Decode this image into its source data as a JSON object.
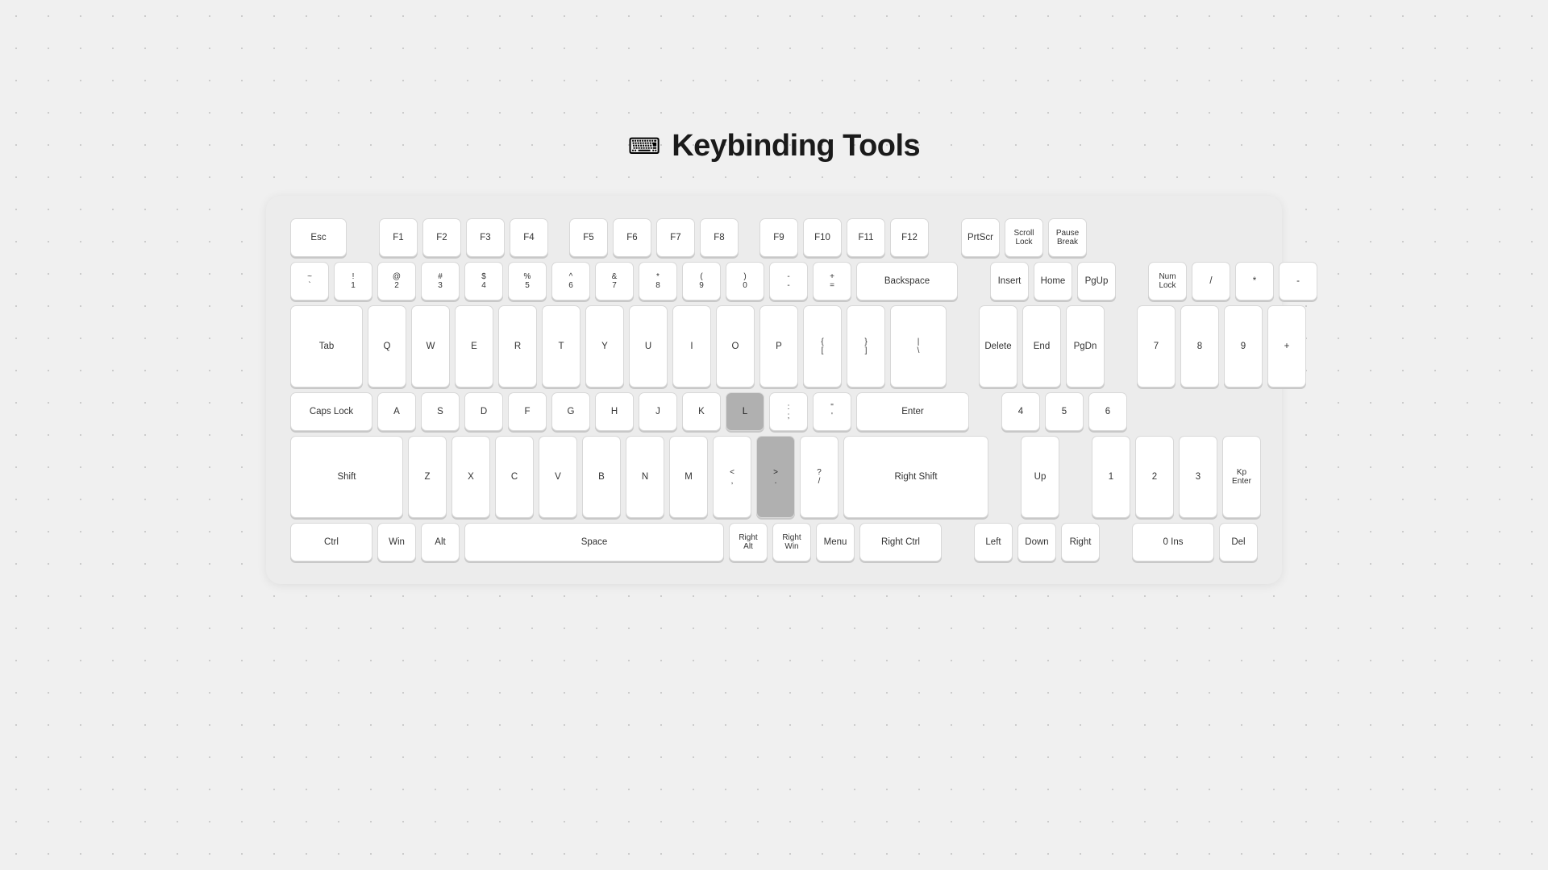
{
  "page": {
    "title": "Keybinding Tools",
    "icon": "⌨"
  },
  "keyboard": {
    "rows": [
      {
        "id": "row-fn",
        "keys": [
          {
            "id": "esc",
            "label": "Esc",
            "w": "w-175"
          },
          {
            "id": "gap1",
            "type": "gap"
          },
          {
            "id": "f1",
            "label": "F1",
            "w": "w-1"
          },
          {
            "id": "f2",
            "label": "F2",
            "w": "w-1"
          },
          {
            "id": "f3",
            "label": "F3",
            "w": "w-1"
          },
          {
            "id": "f4",
            "label": "F4",
            "w": "w-1"
          },
          {
            "id": "gap2",
            "type": "gap-sm"
          },
          {
            "id": "f5",
            "label": "F5",
            "w": "w-1"
          },
          {
            "id": "f6",
            "label": "F6",
            "w": "w-1"
          },
          {
            "id": "f7",
            "label": "F7",
            "w": "w-1"
          },
          {
            "id": "f8",
            "label": "F8",
            "w": "w-1"
          },
          {
            "id": "gap3",
            "type": "gap-sm"
          },
          {
            "id": "f9",
            "label": "F9",
            "w": "w-1"
          },
          {
            "id": "f10",
            "label": "F10",
            "w": "w-1"
          },
          {
            "id": "f11",
            "label": "F11",
            "w": "w-1"
          },
          {
            "id": "f12",
            "label": "F12",
            "w": "w-1"
          },
          {
            "id": "gap4",
            "type": "gap"
          },
          {
            "id": "prtscr",
            "label": "PrtScr",
            "w": "w-1"
          },
          {
            "id": "scrolllock",
            "label": "Scroll\nLock",
            "w": "w-1"
          },
          {
            "id": "pausebreak",
            "label": "Pause\nBreak",
            "w": "w-1"
          }
        ]
      },
      {
        "id": "row-num",
        "keys": [
          {
            "id": "tilde",
            "label": "~\n`",
            "w": "w-1"
          },
          {
            "id": "1",
            "label": "!\n1",
            "w": "w-1"
          },
          {
            "id": "2",
            "label": "@\n2",
            "w": "w-1"
          },
          {
            "id": "3",
            "label": "#\n3",
            "w": "w-1"
          },
          {
            "id": "4",
            "label": "$\n4",
            "w": "w-1"
          },
          {
            "id": "5",
            "label": "%\n5",
            "w": "w-1"
          },
          {
            "id": "6",
            "label": "^\n6",
            "w": "w-1"
          },
          {
            "id": "7",
            "label": "&\n7",
            "w": "w-1"
          },
          {
            "id": "8",
            "label": "*\n8",
            "w": "w-1"
          },
          {
            "id": "9",
            "label": "(\n9",
            "w": "w-1"
          },
          {
            "id": "0",
            "label": ")\n0",
            "w": "w-1"
          },
          {
            "id": "minus",
            "label": "-\n-",
            "w": "w-1"
          },
          {
            "id": "equal",
            "label": "+\n=",
            "w": "w-1"
          },
          {
            "id": "backspace",
            "label": "Backspace",
            "w": "w-3"
          },
          {
            "id": "gap5",
            "type": "gap"
          },
          {
            "id": "insert",
            "label": "Insert",
            "w": "w-1"
          },
          {
            "id": "home",
            "label": "Home",
            "w": "w-1"
          },
          {
            "id": "pgup",
            "label": "PgUp",
            "w": "w-1"
          },
          {
            "id": "gap6",
            "type": "gap"
          },
          {
            "id": "numlock",
            "label": "Num\nLock",
            "w": "w-1"
          },
          {
            "id": "numslash",
            "label": "/",
            "w": "w-1"
          },
          {
            "id": "numstar",
            "label": "*",
            "w": "w-1"
          },
          {
            "id": "numminus",
            "label": "-",
            "w": "w-1"
          }
        ]
      },
      {
        "id": "row-tab",
        "keys": [
          {
            "id": "tab",
            "label": "Tab",
            "w": "w-225"
          },
          {
            "id": "q",
            "label": "Q",
            "w": "w-1"
          },
          {
            "id": "w",
            "label": "W",
            "w": "w-1"
          },
          {
            "id": "e",
            "label": "E",
            "w": "w-1"
          },
          {
            "id": "r",
            "label": "R",
            "w": "w-1"
          },
          {
            "id": "t",
            "label": "T",
            "w": "w-1"
          },
          {
            "id": "y",
            "label": "Y",
            "w": "w-1"
          },
          {
            "id": "u",
            "label": "U",
            "w": "w-1"
          },
          {
            "id": "i",
            "label": "I",
            "w": "w-1"
          },
          {
            "id": "o",
            "label": "O",
            "w": "w-1"
          },
          {
            "id": "p",
            "label": "P",
            "w": "w-1"
          },
          {
            "id": "lbracket",
            "label": "{\n[",
            "w": "w-1"
          },
          {
            "id": "rbracket",
            "label": "}\n]",
            "w": "w-1"
          },
          {
            "id": "backslash",
            "label": "|\n\\",
            "w": "w-175"
          },
          {
            "id": "gap7",
            "type": "gap"
          },
          {
            "id": "delete",
            "label": "Delete",
            "w": "w-1"
          },
          {
            "id": "end",
            "label": "End",
            "w": "w-1"
          },
          {
            "id": "pgdn",
            "label": "PgDn",
            "w": "w-1"
          },
          {
            "id": "gap8",
            "type": "gap"
          },
          {
            "id": "num7",
            "label": "7",
            "w": "w-1"
          },
          {
            "id": "num8",
            "label": "8",
            "w": "w-1"
          },
          {
            "id": "num9",
            "label": "9",
            "w": "w-1"
          },
          {
            "id": "numplus",
            "label": "+",
            "w": "w-1",
            "special": "numpad-plus"
          }
        ]
      },
      {
        "id": "row-caps",
        "keys": [
          {
            "id": "capslock",
            "label": "Caps Lock",
            "w": "w-25"
          },
          {
            "id": "a",
            "label": "A",
            "w": "w-1"
          },
          {
            "id": "s",
            "label": "S",
            "w": "w-1"
          },
          {
            "id": "d",
            "label": "D",
            "w": "w-1"
          },
          {
            "id": "f",
            "label": "F",
            "w": "w-1"
          },
          {
            "id": "g",
            "label": "G",
            "w": "w-1"
          },
          {
            "id": "h",
            "label": "H",
            "w": "w-1"
          },
          {
            "id": "j",
            "label": "J",
            "w": "w-1"
          },
          {
            "id": "k",
            "label": "K",
            "w": "w-1"
          },
          {
            "id": "l",
            "label": "L",
            "w": "w-1",
            "highlight": true
          },
          {
            "id": "semicolon",
            "label": ":\n;",
            "w": "w-1"
          },
          {
            "id": "quote",
            "label": "\"\n'",
            "w": "w-1"
          },
          {
            "id": "enter",
            "label": "Enter",
            "w": "w-35"
          },
          {
            "id": "gap9",
            "type": "gap"
          },
          {
            "id": "num4",
            "label": "4",
            "w": "w-1"
          },
          {
            "id": "num5",
            "label": "5",
            "w": "w-1"
          },
          {
            "id": "num6",
            "label": "6",
            "w": "w-1"
          }
        ]
      },
      {
        "id": "row-shift",
        "keys": [
          {
            "id": "lshift",
            "label": "Shift",
            "w": "w-35"
          },
          {
            "id": "z",
            "label": "Z",
            "w": "w-1"
          },
          {
            "id": "x",
            "label": "X",
            "w": "w-1"
          },
          {
            "id": "c",
            "label": "C",
            "w": "w-1"
          },
          {
            "id": "v",
            "label": "V",
            "w": "w-1"
          },
          {
            "id": "b",
            "label": "B",
            "w": "w-1"
          },
          {
            "id": "n",
            "label": "N",
            "w": "w-1"
          },
          {
            "id": "m",
            "label": "M",
            "w": "w-1"
          },
          {
            "id": "comma",
            "label": "<\n,",
            "w": "w-1"
          },
          {
            "id": "period",
            "label": ">\n.",
            "w": "w-1",
            "highlight": true
          },
          {
            "id": "slash",
            "label": "?\n/",
            "w": "w-1",
            "partial": true
          },
          {
            "id": "rshift",
            "label": "Right Shift",
            "w": "w-45"
          },
          {
            "id": "gap10",
            "type": "gap"
          },
          {
            "id": "up",
            "label": "Up",
            "w": "w-1"
          },
          {
            "id": "gap11",
            "type": "gap"
          },
          {
            "id": "num1",
            "label": "1",
            "w": "w-1"
          },
          {
            "id": "num2",
            "label": "2",
            "w": "w-1"
          },
          {
            "id": "num3",
            "label": "3",
            "w": "w-1"
          },
          {
            "id": "numenter",
            "label": "Kp\nEnter",
            "w": "w-1",
            "special": "numpad-enter"
          }
        ]
      },
      {
        "id": "row-ctrl",
        "keys": [
          {
            "id": "lctrl",
            "label": "Ctrl",
            "w": "w-25"
          },
          {
            "id": "lwin",
            "label": "Win",
            "w": "w-1"
          },
          {
            "id": "lalt",
            "label": "Alt",
            "w": "w-1"
          },
          {
            "id": "space",
            "label": "Space",
            "w": "w-space"
          },
          {
            "id": "ralt",
            "label": "Right\nAlt",
            "w": "w-1"
          },
          {
            "id": "rwin",
            "label": "Right\nWin",
            "w": "w-1"
          },
          {
            "id": "menu",
            "label": "Menu",
            "w": "w-1"
          },
          {
            "id": "rctrl",
            "label": "Right Ctrl",
            "w": "w-25"
          },
          {
            "id": "gap12",
            "type": "gap"
          },
          {
            "id": "left",
            "label": "Left",
            "w": "w-1"
          },
          {
            "id": "down",
            "label": "Down",
            "w": "w-1"
          },
          {
            "id": "right",
            "label": "Right",
            "w": "w-1"
          },
          {
            "id": "gap13",
            "type": "gap"
          },
          {
            "id": "num0",
            "label": "0 Ins",
            "w": "w-25"
          },
          {
            "id": "numdot",
            "label": "Del",
            "w": "w-1"
          }
        ]
      }
    ]
  }
}
